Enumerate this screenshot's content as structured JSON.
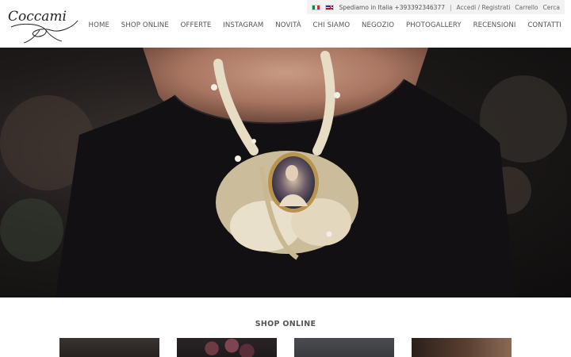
{
  "brand": {
    "logo_text": "Coccami"
  },
  "topbar": {
    "shipping_text": "Spediamo in Italia +393392346377",
    "separator": "|",
    "login_label": "Accedi / Registrati",
    "cart_label": "Carrello",
    "search_label": "Cerca",
    "languages": [
      "it",
      "en"
    ]
  },
  "nav": {
    "items": [
      {
        "label": "HOME"
      },
      {
        "label": "SHOP ONLINE"
      },
      {
        "label": "OFFERTE"
      },
      {
        "label": "INSTAGRAM"
      },
      {
        "label": "NOVITÀ"
      },
      {
        "label": "CHI SIAMO"
      },
      {
        "label": "NEGOZIO"
      },
      {
        "label": "PHOTOGALLERY"
      },
      {
        "label": "RECENSIONI"
      },
      {
        "label": "CONTATTI"
      }
    ]
  },
  "shop_section": {
    "title": "SHOP ONLINE",
    "thumbnails": [
      {
        "subject": "necklace photo"
      },
      {
        "subject": "burgundy beads"
      },
      {
        "subject": "grey product"
      },
      {
        "subject": "model portrait"
      }
    ]
  }
}
